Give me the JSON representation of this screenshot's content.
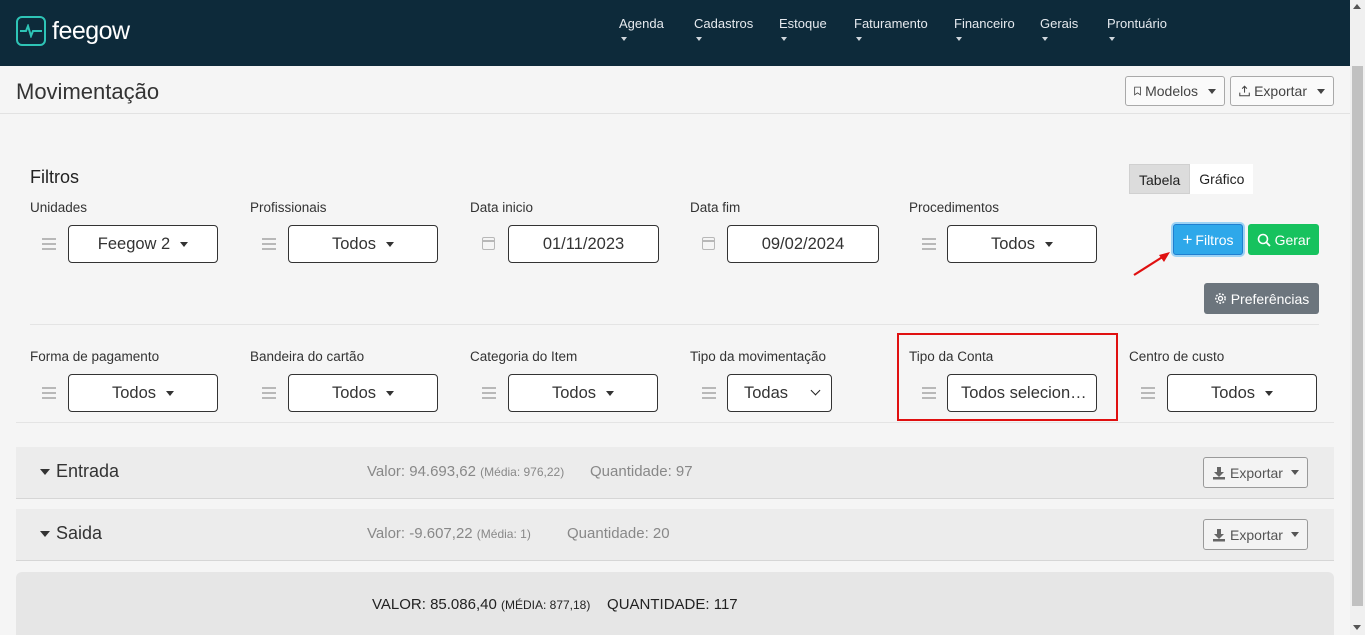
{
  "brand": {
    "name": "feegow"
  },
  "nav": [
    {
      "label": "Agenda"
    },
    {
      "label": "Cadastros"
    },
    {
      "label": "Estoque"
    },
    {
      "label": "Faturamento"
    },
    {
      "label": "Financeiro"
    },
    {
      "label": "Gerais"
    },
    {
      "label": "Prontuário"
    }
  ],
  "page": {
    "title": "Movimentação",
    "modelos_label": "Modelos",
    "exportar_label": "Exportar"
  },
  "filters": {
    "title": "Filtros",
    "view_toggle": {
      "table": "Tabela",
      "chart": "Gráfico",
      "active": "Tabela"
    },
    "row1": [
      {
        "label": "Unidades",
        "value": "Feegow 2"
      },
      {
        "label": "Profissionais",
        "value": "Todos"
      },
      {
        "label": "Data inicio",
        "value": "01/11/2023"
      },
      {
        "label": "Data fim",
        "value": "09/02/2024"
      },
      {
        "label": "Procedimentos",
        "value": "Todos"
      }
    ],
    "row2": [
      {
        "label": "Forma de pagamento",
        "value": "Todos"
      },
      {
        "label": "Bandeira do cartão",
        "value": "Todos"
      },
      {
        "label": "Categoria do Item",
        "value": "Todos"
      },
      {
        "label": "Tipo da movimentação",
        "value": "Todas"
      },
      {
        "label": "Tipo da Conta",
        "value": "Todos selecionados"
      },
      {
        "label": "Centro de custo",
        "value": "Todos"
      }
    ],
    "buttons": {
      "filtros": "Filtros",
      "gerar": "Gerar",
      "preferencias": "Preferências"
    }
  },
  "sections": [
    {
      "title": "Entrada",
      "valor": "Valor: 94.693,62",
      "media": "(Média: 976,22)",
      "quantidade": "Quantidade: 97",
      "export_label": "Exportar"
    },
    {
      "title": "Saida",
      "valor": "Valor: -9.607,22",
      "media": "(Média: 1)",
      "quantidade": "Quantidade: 20",
      "export_label": "Exportar"
    }
  ],
  "total": {
    "valor": "VALOR: 85.086,40",
    "media": "(MÉDIA: 877,18)",
    "quantidade": "QUANTIDADE: 117"
  },
  "colors": {
    "nav_bg": "#0d2a3a",
    "primary": "#2ea8ea",
    "success": "#16c25e",
    "secondary": "#6c757d",
    "highlight": "#e01010"
  }
}
